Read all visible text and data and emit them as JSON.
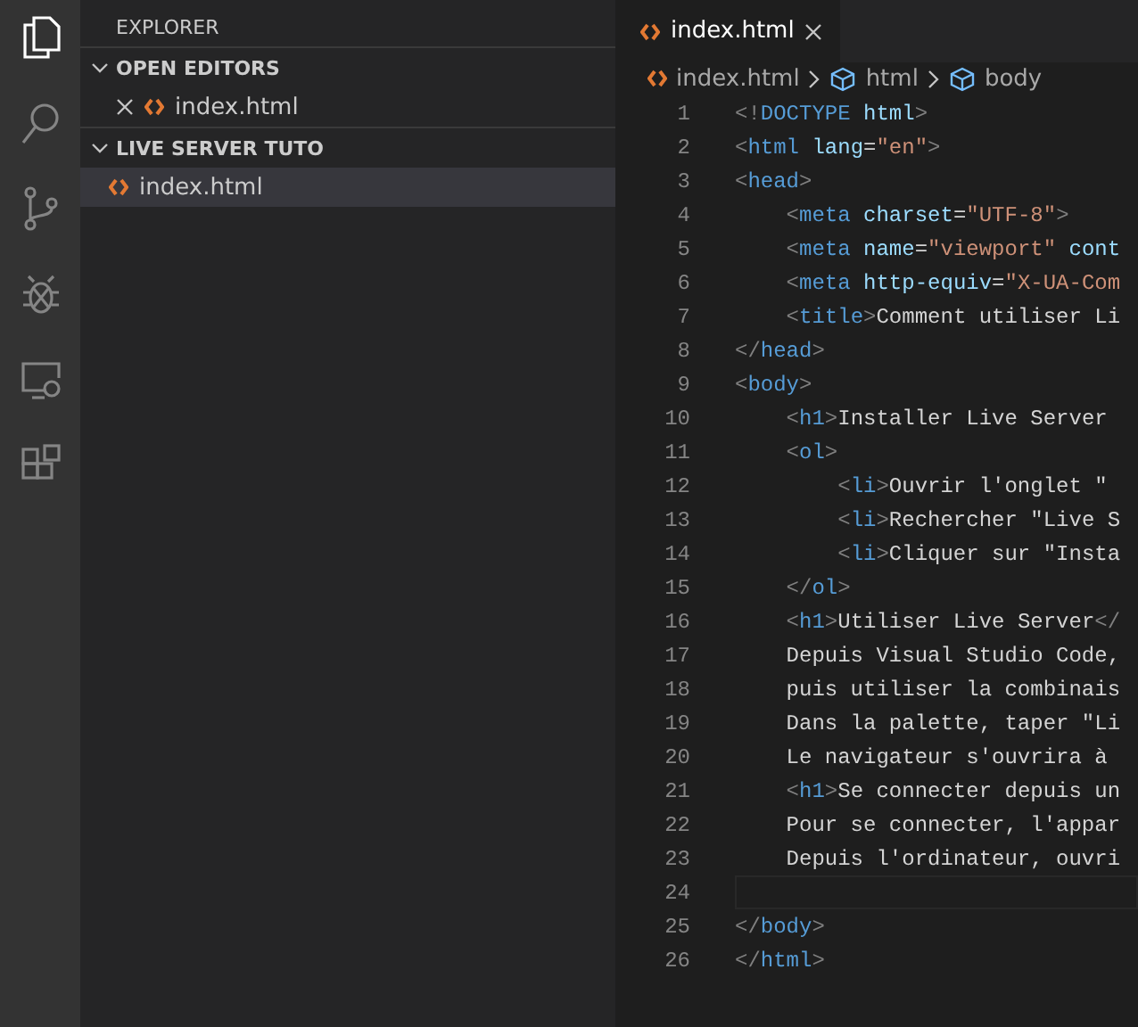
{
  "activity_bar": [
    {
      "kind": "files",
      "selected": true
    },
    {
      "kind": "search",
      "selected": false
    },
    {
      "kind": "scm",
      "selected": false
    },
    {
      "kind": "debug",
      "selected": false
    },
    {
      "kind": "remote",
      "selected": false
    },
    {
      "kind": "extensions",
      "selected": false
    }
  ],
  "sidebar": {
    "title": "EXPLORER",
    "sections": [
      {
        "title": "OPEN EDITORS",
        "expanded": true,
        "items": [
          {
            "label": "index.html",
            "closable": true,
            "selected": false
          }
        ]
      },
      {
        "title": "LIVE SERVER TUTO",
        "expanded": true,
        "items": [
          {
            "label": "index.html",
            "closable": false,
            "selected": true
          }
        ]
      }
    ]
  },
  "tabs": [
    {
      "label": "index.html",
      "selected": true
    }
  ],
  "breadcrumbs": [
    {
      "kind": "file",
      "label": "index.html"
    },
    {
      "kind": "element",
      "label": "html"
    },
    {
      "kind": "element",
      "label": "body"
    }
  ],
  "lines": [
    {
      "number": "1",
      "current": false,
      "tokens": [
        {
          "kind": "punct",
          "text": "<!"
        },
        {
          "kind": "tag",
          "text": "DOCTYPE"
        },
        {
          "kind": "attr",
          "text": " html"
        },
        {
          "kind": "punct",
          "text": ">"
        }
      ]
    },
    {
      "number": "2",
      "current": false,
      "tokens": [
        {
          "kind": "punct",
          "text": "<"
        },
        {
          "kind": "tag",
          "text": "html"
        },
        {
          "kind": "attr",
          "text": " lang"
        },
        {
          "kind": "plain",
          "text": "="
        },
        {
          "kind": "string",
          "text": "\"en\""
        },
        {
          "kind": "punct",
          "text": ">"
        }
      ]
    },
    {
      "number": "3",
      "current": false,
      "tokens": [
        {
          "kind": "punct",
          "text": "<"
        },
        {
          "kind": "tag",
          "text": "head"
        },
        {
          "kind": "punct",
          "text": ">"
        }
      ]
    },
    {
      "number": "4",
      "current": false,
      "tokens": [
        {
          "kind": "punct",
          "text": "    <"
        },
        {
          "kind": "tag",
          "text": "meta"
        },
        {
          "kind": "attr",
          "text": " charset"
        },
        {
          "kind": "plain",
          "text": "="
        },
        {
          "kind": "string",
          "text": "\"UTF-8\""
        },
        {
          "kind": "punct",
          "text": ">"
        }
      ]
    },
    {
      "number": "5",
      "current": false,
      "tokens": [
        {
          "kind": "punct",
          "text": "    <"
        },
        {
          "kind": "tag",
          "text": "meta"
        },
        {
          "kind": "attr",
          "text": " name"
        },
        {
          "kind": "plain",
          "text": "="
        },
        {
          "kind": "string",
          "text": "\"viewport\""
        },
        {
          "kind": "attr",
          "text": " cont"
        }
      ]
    },
    {
      "number": "6",
      "current": false,
      "tokens": [
        {
          "kind": "punct",
          "text": "    <"
        },
        {
          "kind": "tag",
          "text": "meta"
        },
        {
          "kind": "attr",
          "text": " http-equiv"
        },
        {
          "kind": "plain",
          "text": "="
        },
        {
          "kind": "string",
          "text": "\"X-UA-Com"
        }
      ]
    },
    {
      "number": "7",
      "current": false,
      "tokens": [
        {
          "kind": "punct",
          "text": "    <"
        },
        {
          "kind": "tag",
          "text": "title"
        },
        {
          "kind": "punct",
          "text": ">"
        },
        {
          "kind": "plain",
          "text": "Comment utiliser Li"
        }
      ]
    },
    {
      "number": "8",
      "current": false,
      "tokens": [
        {
          "kind": "punct",
          "text": "</"
        },
        {
          "kind": "tag",
          "text": "head"
        },
        {
          "kind": "punct",
          "text": ">"
        }
      ]
    },
    {
      "number": "9",
      "current": false,
      "tokens": [
        {
          "kind": "punct",
          "text": "<"
        },
        {
          "kind": "tag",
          "text": "body"
        },
        {
          "kind": "punct",
          "text": ">"
        }
      ]
    },
    {
      "number": "10",
      "current": false,
      "tokens": [
        {
          "kind": "punct",
          "text": "    <"
        },
        {
          "kind": "tag",
          "text": "h1"
        },
        {
          "kind": "punct",
          "text": ">"
        },
        {
          "kind": "plain",
          "text": "Installer Live Server"
        }
      ]
    },
    {
      "number": "11",
      "current": false,
      "tokens": [
        {
          "kind": "punct",
          "text": "    <"
        },
        {
          "kind": "tag",
          "text": "ol"
        },
        {
          "kind": "punct",
          "text": ">"
        }
      ]
    },
    {
      "number": "12",
      "current": false,
      "tokens": [
        {
          "kind": "punct",
          "text": "        <"
        },
        {
          "kind": "tag",
          "text": "li"
        },
        {
          "kind": "punct",
          "text": ">"
        },
        {
          "kind": "plain",
          "text": "Ouvrir l'onglet \""
        }
      ]
    },
    {
      "number": "13",
      "current": false,
      "tokens": [
        {
          "kind": "punct",
          "text": "        <"
        },
        {
          "kind": "tag",
          "text": "li"
        },
        {
          "kind": "punct",
          "text": ">"
        },
        {
          "kind": "plain",
          "text": "Rechercher \"Live S"
        }
      ]
    },
    {
      "number": "14",
      "current": false,
      "tokens": [
        {
          "kind": "punct",
          "text": "        <"
        },
        {
          "kind": "tag",
          "text": "li"
        },
        {
          "kind": "punct",
          "text": ">"
        },
        {
          "kind": "plain",
          "text": "Cliquer sur \"Insta"
        }
      ]
    },
    {
      "number": "15",
      "current": false,
      "tokens": [
        {
          "kind": "punct",
          "text": "    </"
        },
        {
          "kind": "tag",
          "text": "ol"
        },
        {
          "kind": "punct",
          "text": ">"
        }
      ]
    },
    {
      "number": "16",
      "current": false,
      "tokens": [
        {
          "kind": "punct",
          "text": "    <"
        },
        {
          "kind": "tag",
          "text": "h1"
        },
        {
          "kind": "punct",
          "text": ">"
        },
        {
          "kind": "plain",
          "text": "Utiliser Live Server"
        },
        {
          "kind": "punct",
          "text": "</"
        }
      ]
    },
    {
      "number": "17",
      "current": false,
      "tokens": [
        {
          "kind": "plain",
          "text": "    Depuis Visual Studio Code,"
        }
      ]
    },
    {
      "number": "18",
      "current": false,
      "tokens": [
        {
          "kind": "plain",
          "text": "    puis utiliser la combinais"
        }
      ]
    },
    {
      "number": "19",
      "current": false,
      "tokens": [
        {
          "kind": "plain",
          "text": "    Dans la palette, taper \"Li"
        }
      ]
    },
    {
      "number": "20",
      "current": false,
      "tokens": [
        {
          "kind": "plain",
          "text": "    Le navigateur s'ouvrira à"
        }
      ]
    },
    {
      "number": "21",
      "current": false,
      "tokens": [
        {
          "kind": "punct",
          "text": "    <"
        },
        {
          "kind": "tag",
          "text": "h1"
        },
        {
          "kind": "punct",
          "text": ">"
        },
        {
          "kind": "plain",
          "text": "Se connecter depuis un"
        }
      ]
    },
    {
      "number": "22",
      "current": false,
      "tokens": [
        {
          "kind": "plain",
          "text": "    Pour se connecter, l'appar"
        }
      ]
    },
    {
      "number": "23",
      "current": false,
      "tokens": [
        {
          "kind": "plain",
          "text": "    Depuis l'ordinateur, ouvri"
        }
      ]
    },
    {
      "number": "24",
      "current": true
    },
    {
      "number": "25",
      "current": false,
      "tokens": [
        {
          "kind": "punct",
          "text": "</"
        },
        {
          "kind": "tag",
          "text": "body"
        },
        {
          "kind": "punct",
          "text": ">"
        }
      ]
    },
    {
      "number": "26",
      "current": false,
      "tokens": [
        {
          "kind": "punct",
          "text": "</"
        },
        {
          "kind": "tag",
          "text": "html"
        },
        {
          "kind": "punct",
          "text": ">"
        }
      ]
    }
  ]
}
